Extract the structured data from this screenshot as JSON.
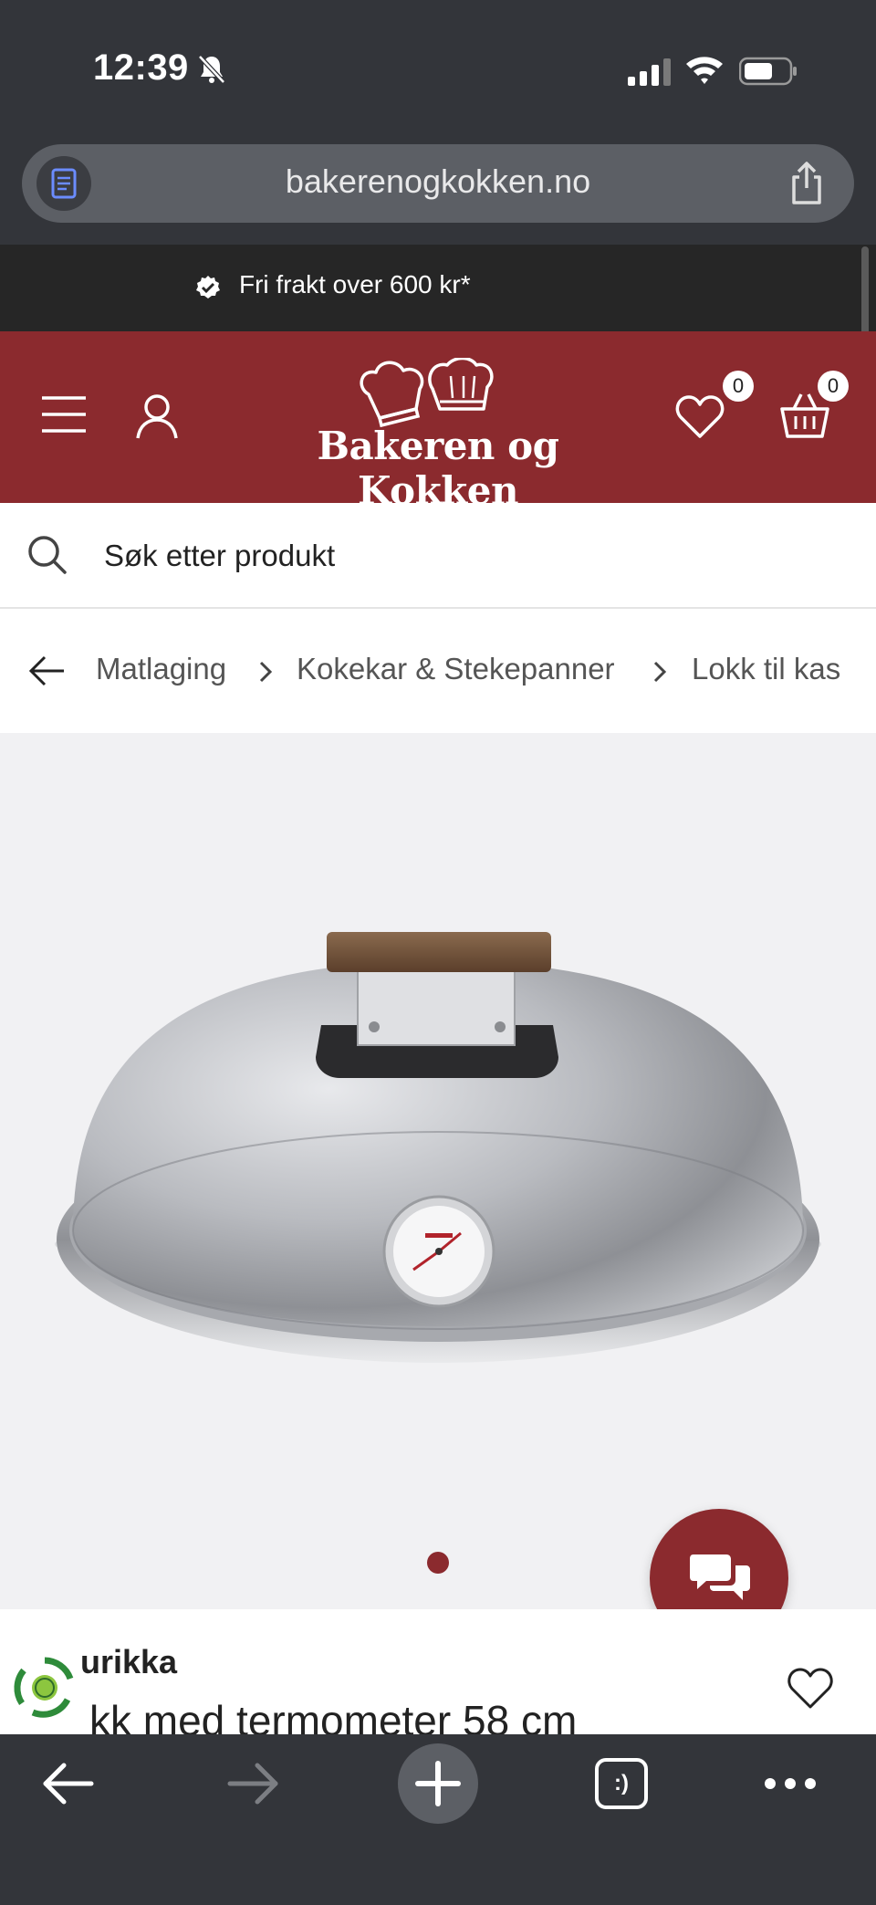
{
  "status_bar": {
    "time": "12:39"
  },
  "browser": {
    "url": "bakerenogkokken.no",
    "tabs_label": ":)"
  },
  "promo": {
    "text": "Fri frakt over 600 kr*"
  },
  "header": {
    "logo_text": "Bakeren og Kokken",
    "wishlist_count": "0",
    "cart_count": "0",
    "brand_color": "#8b2a2e"
  },
  "search": {
    "placeholder": "Søk etter produkt"
  },
  "breadcrumb": {
    "items": [
      "Matlaging",
      "Kokekar & Stekepanner",
      "Lokk til kas"
    ]
  },
  "product": {
    "brand": "urikka",
    "title": "kk med termometer 58 cm",
    "image_dots_active": 1
  },
  "icons": {
    "menu": "hamburger-icon",
    "account": "user-icon",
    "wishlist": "heart-icon",
    "cart": "basket-icon",
    "search": "search-icon",
    "chat": "chat-bubbles-icon"
  }
}
